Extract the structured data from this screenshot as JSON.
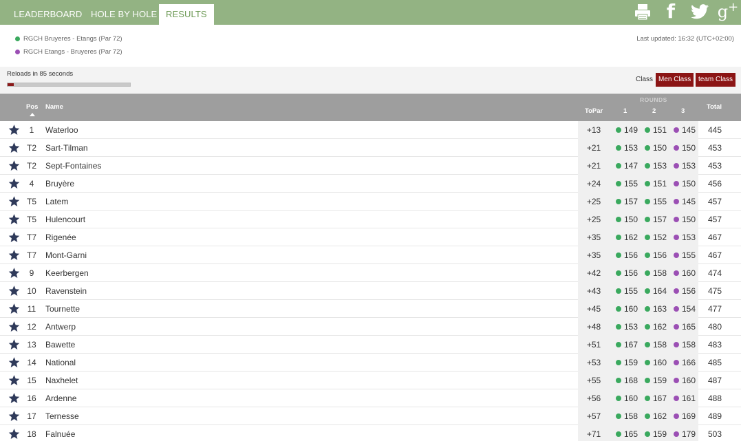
{
  "tabs": [
    {
      "label": "LEADERBOARD"
    },
    {
      "label": "HOLE BY HOLE"
    },
    {
      "label": "RESULTS",
      "active": true
    }
  ],
  "social": [
    "print-icon",
    "facebook-icon",
    "twitter-icon",
    "google-plus-icon"
  ],
  "social_text": {
    "facebook": "f",
    "google_plus": "g",
    "google_plus_sup": "+"
  },
  "courses": [
    {
      "label": "RGCH Bruyeres - Etangs (Par 72)",
      "color": "#3aa95e"
    },
    {
      "label": "RGCH Etangs - Bruyeres (Par 72)",
      "color": "#9b4fb4"
    }
  ],
  "last_updated": "Last updated: 16:32 (UTC+02:00)",
  "reload": {
    "text": "Reloads in 85 seconds",
    "progress": 0.05
  },
  "class_filter": {
    "label": "Class",
    "buttons": [
      "Men Class",
      "team Class"
    ]
  },
  "columns": {
    "pos": "Pos",
    "name": "Name",
    "topar": "ToPar",
    "rounds": "ROUNDS",
    "r1": "1",
    "r2": "2",
    "r3": "3",
    "total": "Total"
  },
  "colors": {
    "nav": "#93b383",
    "round_green": "#3aa95e",
    "round_purple": "#9b4fb4",
    "button": "#8b1515",
    "star": "#2f3a5a"
  },
  "rows": [
    {
      "pos": "1",
      "name": "Waterloo",
      "topar": "+13",
      "r1": "149",
      "r2": "151",
      "r3": "145",
      "total": "445"
    },
    {
      "pos": "T2",
      "name": "Sart-Tilman",
      "topar": "+21",
      "r1": "153",
      "r2": "150",
      "r3": "150",
      "total": "453"
    },
    {
      "pos": "T2",
      "name": "Sept-Fontaines",
      "topar": "+21",
      "r1": "147",
      "r2": "153",
      "r3": "153",
      "total": "453"
    },
    {
      "pos": "4",
      "name": "Bruyère",
      "topar": "+24",
      "r1": "155",
      "r2": "151",
      "r3": "150",
      "total": "456"
    },
    {
      "pos": "T5",
      "name": "Latem",
      "topar": "+25",
      "r1": "157",
      "r2": "155",
      "r3": "145",
      "total": "457"
    },
    {
      "pos": "T5",
      "name": "Hulencourt",
      "topar": "+25",
      "r1": "150",
      "r2": "157",
      "r3": "150",
      "total": "457"
    },
    {
      "pos": "T7",
      "name": "Rigenée",
      "topar": "+35",
      "r1": "162",
      "r2": "152",
      "r3": "153",
      "total": "467"
    },
    {
      "pos": "T7",
      "name": "Mont-Garni",
      "topar": "+35",
      "r1": "156",
      "r2": "156",
      "r3": "155",
      "total": "467"
    },
    {
      "pos": "9",
      "name": "Keerbergen",
      "topar": "+42",
      "r1": "156",
      "r2": "158",
      "r3": "160",
      "total": "474"
    },
    {
      "pos": "10",
      "name": "Ravenstein",
      "topar": "+43",
      "r1": "155",
      "r2": "164",
      "r3": "156",
      "total": "475"
    },
    {
      "pos": "11",
      "name": "Tournette",
      "topar": "+45",
      "r1": "160",
      "r2": "163",
      "r3": "154",
      "total": "477"
    },
    {
      "pos": "12",
      "name": "Antwerp",
      "topar": "+48",
      "r1": "153",
      "r2": "162",
      "r3": "165",
      "total": "480"
    },
    {
      "pos": "13",
      "name": "Bawette",
      "topar": "+51",
      "r1": "167",
      "r2": "158",
      "r3": "158",
      "total": "483"
    },
    {
      "pos": "14",
      "name": "National",
      "topar": "+53",
      "r1": "159",
      "r2": "160",
      "r3": "166",
      "total": "485"
    },
    {
      "pos": "15",
      "name": "Naxhelet",
      "topar": "+55",
      "r1": "168",
      "r2": "159",
      "r3": "160",
      "total": "487"
    },
    {
      "pos": "16",
      "name": "Ardenne",
      "topar": "+56",
      "r1": "160",
      "r2": "167",
      "r3": "161",
      "total": "488"
    },
    {
      "pos": "17",
      "name": "Ternesse",
      "topar": "+57",
      "r1": "158",
      "r2": "162",
      "r3": "169",
      "total": "489"
    },
    {
      "pos": "18",
      "name": "Falnuée",
      "topar": "+71",
      "r1": "165",
      "r2": "159",
      "r3": "179",
      "total": "503"
    }
  ]
}
